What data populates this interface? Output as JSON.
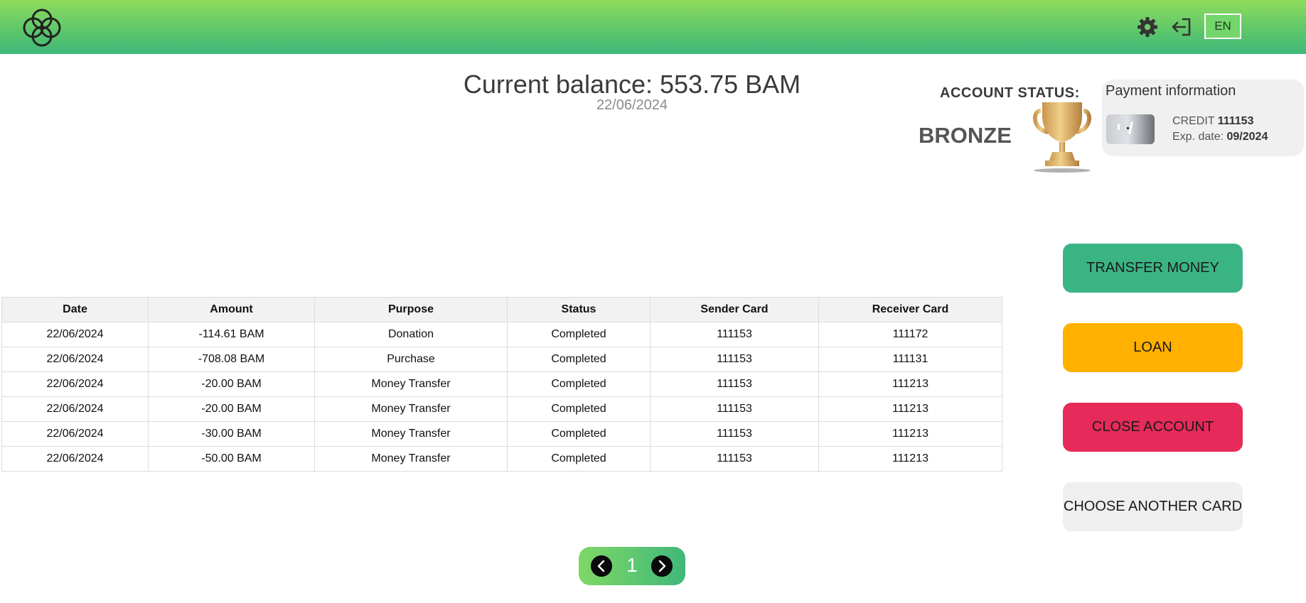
{
  "header": {
    "logo_icon": "four-circle-clover-logo",
    "settings_icon": "gear-icon",
    "logout_icon": "logout-icon",
    "language_label": "EN"
  },
  "balance": {
    "title": "Current balance: 553.75 BAM",
    "date": "22/06/2024"
  },
  "account_status": {
    "label": "ACCOUNT STATUS:",
    "value": "BRONZE",
    "icon": "trophy-icon"
  },
  "payment_info": {
    "title": "Payment information",
    "card_type": "CREDIT",
    "card_number": "111153",
    "exp_label": "Exp. date:",
    "exp_date": "09/2024"
  },
  "transactions": {
    "columns": [
      "Date",
      "Amount",
      "Purpose",
      "Status",
      "Sender Card",
      "Receiver Card"
    ],
    "rows": [
      [
        "22/06/2024",
        "-114.61 BAM",
        "Donation",
        "Completed",
        "111153",
        "111172"
      ],
      [
        "22/06/2024",
        "-708.08 BAM",
        "Purchase",
        "Completed",
        "111153",
        "111131"
      ],
      [
        "22/06/2024",
        "-20.00 BAM",
        "Money Transfer",
        "Completed",
        "111153",
        "111213"
      ],
      [
        "22/06/2024",
        "-20.00 BAM",
        "Money Transfer",
        "Completed",
        "111153",
        "111213"
      ],
      [
        "22/06/2024",
        "-30.00 BAM",
        "Money Transfer",
        "Completed",
        "111153",
        "111213"
      ],
      [
        "22/06/2024",
        "-50.00 BAM",
        "Money Transfer",
        "Completed",
        "111153",
        "111213"
      ]
    ]
  },
  "actions": {
    "transfer": "TRANSFER MONEY",
    "loan": "LOAN",
    "close": "CLOSE ACCOUNT",
    "choose_card": "CHOOSE ANOTHER CARD"
  },
  "pagination": {
    "current_page": "1",
    "prev_icon": "chevron-left-icon",
    "next_icon": "chevron-right-icon"
  },
  "colors": {
    "header_gradient_start": "#8fdc5c",
    "header_gradient_end": "#3fb87a",
    "transfer": "#3bb484",
    "loan": "#ffb000",
    "close": "#e62a5a",
    "choose": "#efefef"
  }
}
